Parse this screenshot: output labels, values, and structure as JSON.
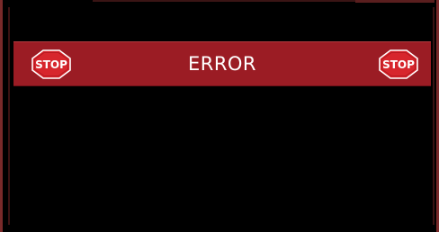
{
  "dialog": {
    "title": "ERROR",
    "left_icon": {
      "name": "stop-sign-icon",
      "text": "STOP"
    },
    "right_icon": {
      "name": "stop-sign-icon",
      "text": "STOP"
    },
    "message": ""
  },
  "colors": {
    "banner": "#9b1c24",
    "background": "#000000",
    "title_text": "#ffffff",
    "frame": "#7a2a2a"
  }
}
